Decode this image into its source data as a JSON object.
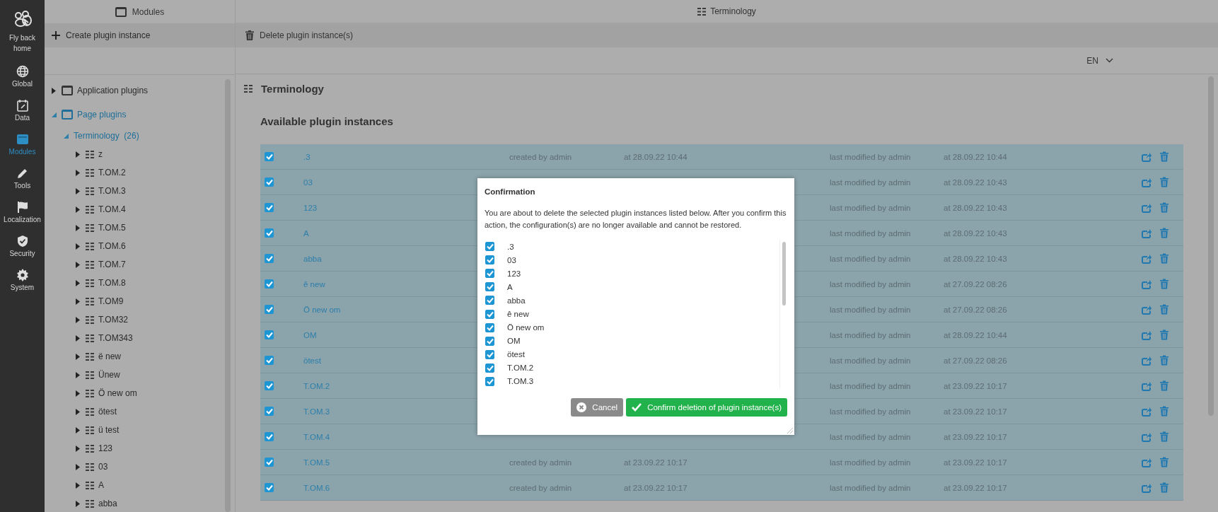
{
  "rail": {
    "items": [
      {
        "label": "Fly back home",
        "selected": false
      },
      {
        "label": "Global",
        "selected": false
      },
      {
        "label": "Data",
        "selected": false
      },
      {
        "label": "Modules",
        "selected": true
      },
      {
        "label": "Tools",
        "selected": false
      },
      {
        "label": "Localization",
        "selected": false
      },
      {
        "label": "Security",
        "selected": false
      },
      {
        "label": "System",
        "selected": false
      }
    ]
  },
  "modules_panel": {
    "title": "Modules",
    "toolbar": [
      {
        "label": "Create plugin instance"
      }
    ],
    "tree": [
      {
        "label": "Application plugins",
        "selected": false,
        "expanded": false
      },
      {
        "label": "Page plugins",
        "selected": true,
        "expanded": true,
        "children": [
          {
            "label": "Terminology",
            "count": "(26)",
            "selected": true,
            "expanded": true,
            "children": [
              {
                "label": "z",
                "selected": false,
                "expanded": false
              },
              {
                "label": "T.OM.2",
                "selected": false,
                "expanded": false
              },
              {
                "label": "T.OM.3",
                "selected": false,
                "expanded": false
              },
              {
                "label": "T.OM.4",
                "selected": false,
                "expanded": false
              },
              {
                "label": "T.OM.5",
                "selected": false,
                "expanded": false
              },
              {
                "label": "T.OM.6",
                "selected": false,
                "expanded": false
              },
              {
                "label": "T.OM.7",
                "selected": false,
                "expanded": false
              },
              {
                "label": "T.OM.8",
                "selected": false,
                "expanded": false
              },
              {
                "label": "T.OM9",
                "selected": false,
                "expanded": false
              },
              {
                "label": "T.OM32",
                "selected": false,
                "expanded": false
              },
              {
                "label": "T.OM343",
                "selected": false,
                "expanded": false
              },
              {
                "label": "ë new",
                "selected": false,
                "expanded": false
              },
              {
                "label": "Ünew",
                "selected": false,
                "expanded": false
              },
              {
                "label": "Ö new om",
                "selected": false,
                "expanded": false
              },
              {
                "label": "ötest",
                "selected": false,
                "expanded": false
              },
              {
                "label": "ü test",
                "selected": false,
                "expanded": false
              },
              {
                "label": "123",
                "selected": false,
                "expanded": false
              },
              {
                "label": "03",
                "selected": false,
                "expanded": false
              },
              {
                "label": "A",
                "selected": false,
                "expanded": false
              },
              {
                "label": "abba",
                "selected": false,
                "expanded": false
              }
            ]
          }
        ]
      }
    ]
  },
  "main": {
    "title": "Terminology",
    "toolbar": [
      {
        "label": "Delete plugin instance(s)"
      }
    ],
    "language": "EN",
    "heading": "Terminology",
    "subheading": "Available plugin instances",
    "rows": [
      {
        "name": ".3",
        "checked": true,
        "created": "created by admin",
        "created_at": "at 28.09.22 10:44",
        "modified": "last modified by admin",
        "modified_at": "at 28.09.22 10:44"
      },
      {
        "name": "03",
        "checked": true,
        "modified": "last modified by admin",
        "modified_at": "at 28.09.22 10:43"
      },
      {
        "name": "123",
        "checked": true,
        "modified": "last modified by admin",
        "modified_at": "at 28.09.22 10:43"
      },
      {
        "name": "A",
        "checked": true,
        "modified": "last modified by admin",
        "modified_at": "at 28.09.22 10:43"
      },
      {
        "name": "abba",
        "checked": true,
        "modified": "last modified by admin",
        "modified_at": "at 28.09.22 10:43"
      },
      {
        "name": "ê new",
        "checked": true,
        "modified": "last modified by admin",
        "modified_at": "at 27.09.22 08:26"
      },
      {
        "name": "Ö new om",
        "checked": true,
        "modified": "last modified by admin",
        "modified_at": "at 27.09.22 08:26"
      },
      {
        "name": "OM",
        "checked": true,
        "modified": "last modified by admin",
        "modified_at": "at 28.09.22 10:44"
      },
      {
        "name": "ötest",
        "checked": true,
        "modified": "last modified by admin",
        "modified_at": "at 27.09.22 08:26"
      },
      {
        "name": "T.OM.2",
        "checked": true,
        "modified": "last modified by admin",
        "modified_at": "at 23.09.22 10:17"
      },
      {
        "name": "T.OM.3",
        "checked": true,
        "modified": "last modified by admin",
        "modified_at": "at 23.09.22 10:17"
      },
      {
        "name": "T.OM.4",
        "checked": true,
        "modified": "last modified by admin",
        "modified_at": "at 23.09.22 10:17"
      },
      {
        "name": "T.OM.5",
        "checked": true,
        "created": "created by admin",
        "created_at": "at 23.09.22 10:17",
        "modified": "last modified by admin",
        "modified_at": "at 23.09.22 10:17"
      },
      {
        "name": "T.OM.6",
        "checked": true,
        "created": "created by admin",
        "created_at": "at 23.09.22 10:17",
        "modified": "last modified by admin",
        "modified_at": "at 23.09.22 10:17"
      }
    ]
  },
  "dialog": {
    "title": "Confirmation",
    "message": "You are about to delete the selected plugin instances listed below. After you confirm this action, the configuration(s) are no longer available and cannot be restored.",
    "items": [
      {
        "label": ".3",
        "checked": true
      },
      {
        "label": "03",
        "checked": true
      },
      {
        "label": "123",
        "checked": true
      },
      {
        "label": "A",
        "checked": true
      },
      {
        "label": "abba",
        "checked": true
      },
      {
        "label": "ê new",
        "checked": true
      },
      {
        "label": "Ö new om",
        "checked": true
      },
      {
        "label": "OM",
        "checked": true
      },
      {
        "label": "ötest",
        "checked": true
      },
      {
        "label": "T.OM.2",
        "checked": true
      },
      {
        "label": "T.OM.3",
        "checked": true
      }
    ],
    "buttons": [
      {
        "label": "Cancel",
        "kind": "cancel"
      },
      {
        "label": "Confirm deletion of plugin instance(s)",
        "kind": "confirm"
      }
    ]
  }
}
